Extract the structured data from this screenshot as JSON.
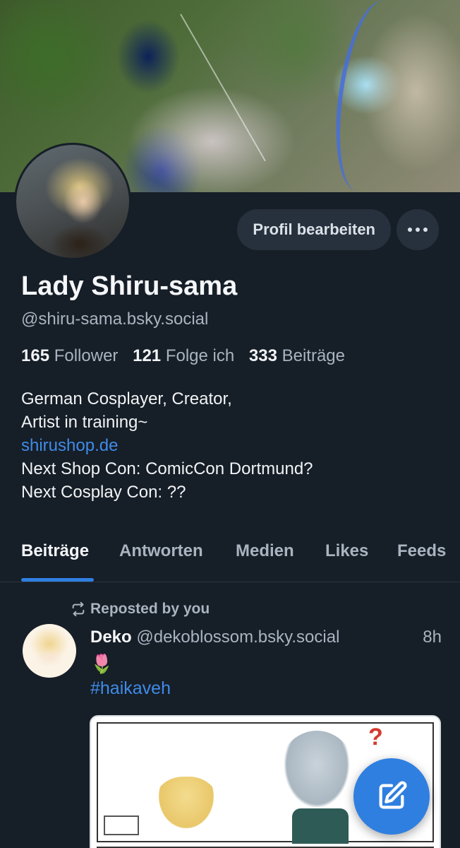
{
  "profile": {
    "display_name": "Lady Shiru-sama",
    "handle": "@shiru-sama.bsky.social",
    "edit_label": "Profil bearbeiten",
    "more_label": "…",
    "stats": {
      "followers_count": "165",
      "followers_label": "Follower",
      "following_count": "121",
      "following_label": "Folge ich",
      "posts_count": "333",
      "posts_label": "Beiträge"
    },
    "bio": {
      "line1": "German Cosplayer, Creator,",
      "line2": "Artist in training~",
      "link": "shirushop.de",
      "line3": "Next Shop Con: ComicCon Dortmund?",
      "line4": "Next Cosplay Con: ??"
    }
  },
  "tabs": [
    {
      "label": "Beiträge",
      "active": true
    },
    {
      "label": "Antworten",
      "active": false
    },
    {
      "label": "Medien",
      "active": false
    },
    {
      "label": "Likes",
      "active": false
    },
    {
      "label": "Feeds",
      "active": false
    }
  ],
  "feed": {
    "repost_label": "Reposted by you",
    "post": {
      "author": "Deko",
      "handle": "@dekoblossom.bsky.social",
      "time": "8h",
      "emoji": "🌷",
      "hashtag": "#haikaveh",
      "image_mark": "?"
    }
  },
  "icons": {
    "repost": "repost-icon",
    "compose": "compose-icon",
    "more": "ellipsis-icon"
  },
  "colors": {
    "background": "#161e27",
    "accent": "#2f7fe0",
    "link": "#3f8be8",
    "button": "#27313d"
  }
}
